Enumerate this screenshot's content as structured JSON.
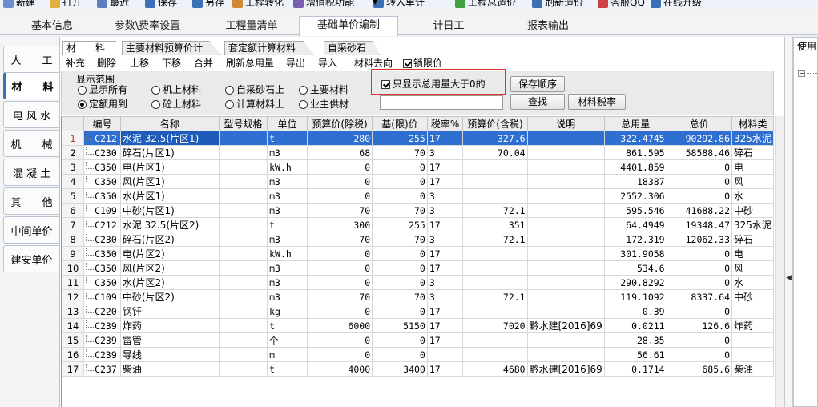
{
  "toolbar": [
    {
      "label": "新建",
      "color": "#6a8fd0"
    },
    {
      "label": "打开",
      "color": "#e0b040"
    },
    {
      "label": "最近",
      "color": "#5a7fc0"
    },
    {
      "label": "保存",
      "color": "#3b6fb6"
    },
    {
      "label": "另存",
      "color": "#3b6fb6"
    },
    {
      "label": "工程转化",
      "color": "#d08a30"
    },
    {
      "label": "增值税功能",
      "color": "#7a5fb0"
    },
    {
      "label": "转入单计",
      "color": "#3b6fb6"
    },
    {
      "label": "工程总造价",
      "color": "#40a040"
    },
    {
      "label": "刷新造价",
      "color": "#3b6fb6"
    },
    {
      "label": "答服QQ",
      "color": "#d04040"
    },
    {
      "label": "在线升级",
      "color": "#3b6fb6"
    }
  ],
  "main_tabs": [
    "基本信息",
    "参数\\费率设置",
    "工程量清单",
    "基础单价编制",
    "计日工",
    "报表输出"
  ],
  "main_tab_active": 3,
  "side_tabs": [
    "人　　工",
    "材　　料",
    "电 风 水",
    "机　　械",
    "混 凝 土",
    "其　　他",
    "中间单价",
    "建安单价"
  ],
  "side_tab_active": 1,
  "sub_tabs": [
    "材　　料",
    "主要材料预算价计算",
    "套定额计算材料单价",
    "自采砂石料"
  ],
  "menu": [
    "补充",
    "删除",
    "上移",
    "下移",
    "合并",
    "刷新总用量",
    "导出",
    "导入",
    "材料去向"
  ],
  "lock_label": "锁限价",
  "lock_checked": true,
  "filter": {
    "title": "显示范围",
    "radios": [
      {
        "label": "显示所有",
        "checked": false
      },
      {
        "label": "定额用到",
        "checked": true
      },
      {
        "label": "机上材料",
        "checked": false
      },
      {
        "label": "砼上材料",
        "checked": false
      },
      {
        "label": "自采砂石上",
        "checked": false
      },
      {
        "label": "计算材料上",
        "checked": false
      },
      {
        "label": "主要材料",
        "checked": false
      },
      {
        "label": "业主供材",
        "checked": false
      }
    ],
    "only_positive_label": "只显示总用量大于0的",
    "only_positive_checked": true,
    "search_value": "",
    "save_order_label": "保存顺序",
    "find_label": "查找",
    "tax_rate_label": "材料税率",
    "highlight_color": "#e03030"
  },
  "right_pane_label": "使用",
  "grid": {
    "headers": [
      "",
      "编号",
      "名称",
      "型号规格",
      "单位",
      "预算价(除税)",
      "基(限)价",
      "税率%",
      "预算价(含税)",
      "说明",
      "总用量",
      "总价",
      "材料类"
    ],
    "selected_row": 0,
    "selection_color": "#2f6fd1",
    "rows": [
      [
        "1",
        "C212",
        "水泥 32.5(片区1)",
        "",
        "t",
        "280",
        "255",
        "17",
        "327.6",
        "",
        "322.4745",
        "90292.86",
        "325水泥"
      ],
      [
        "2",
        "C230",
        "碎石(片区1)",
        "",
        "m3",
        "68",
        "70",
        "3",
        "70.04",
        "",
        "861.595",
        "58588.46",
        "碎石"
      ],
      [
        "3",
        "C350",
        "电(片区1)",
        "",
        "kW.h",
        "0",
        "0",
        "17",
        "",
        "",
        "4401.859",
        "0",
        "电"
      ],
      [
        "4",
        "C350",
        "风(片区1)",
        "",
        "m3",
        "0",
        "0",
        "17",
        "",
        "",
        "18387",
        "0",
        "风"
      ],
      [
        "5",
        "C350",
        "水(片区1)",
        "",
        "m3",
        "0",
        "0",
        "3",
        "",
        "",
        "2552.306",
        "0",
        "水"
      ],
      [
        "6",
        "C109",
        "中砂(片区1)",
        "",
        "m3",
        "70",
        "70",
        "3",
        "72.1",
        "",
        "595.546",
        "41688.22",
        "中砂"
      ],
      [
        "7",
        "C212",
        "水泥 32.5(片区2)",
        "",
        "t",
        "300",
        "255",
        "17",
        "351",
        "",
        "64.4949",
        "19348.47",
        "325水泥"
      ],
      [
        "8",
        "C230",
        "碎石(片区2)",
        "",
        "m3",
        "70",
        "70",
        "3",
        "72.1",
        "",
        "172.319",
        "12062.33",
        "碎石"
      ],
      [
        "9",
        "C350",
        "电(片区2)",
        "",
        "kW.h",
        "0",
        "0",
        "17",
        "",
        "",
        "301.9058",
        "0",
        "电"
      ],
      [
        "10",
        "C350",
        "风(片区2)",
        "",
        "m3",
        "0",
        "0",
        "17",
        "",
        "",
        "534.6",
        "0",
        "风"
      ],
      [
        "11",
        "C350",
        "水(片区2)",
        "",
        "m3",
        "0",
        "0",
        "3",
        "",
        "",
        "290.8292",
        "0",
        "水"
      ],
      [
        "12",
        "C109",
        "中砂(片区2)",
        "",
        "m3",
        "70",
        "70",
        "3",
        "72.1",
        "",
        "119.1092",
        "8337.64",
        "中砂"
      ],
      [
        "13",
        "C220",
        "钢钎",
        "",
        "kg",
        "0",
        "0",
        "17",
        "",
        "",
        "0.39",
        "0",
        ""
      ],
      [
        "14",
        "C239",
        "炸药",
        "",
        "t",
        "6000",
        "5150",
        "17",
        "7020",
        "黔水建[2016]69",
        "0.0211",
        "126.6",
        "炸药"
      ],
      [
        "15",
        "C239",
        "雷管",
        "",
        "个",
        "0",
        "0",
        "17",
        "",
        "",
        "28.35",
        "0",
        ""
      ],
      [
        "16",
        "C239",
        "导线",
        "",
        "m",
        "0",
        "0",
        "",
        "",
        "",
        "56.61",
        "0",
        ""
      ],
      [
        "17",
        "C237",
        "柴油",
        "",
        "t",
        "4000",
        "3400",
        "17",
        "4680",
        "黔水建[2016]69",
        "0.1714",
        "685.6",
        "柴油"
      ]
    ]
  }
}
